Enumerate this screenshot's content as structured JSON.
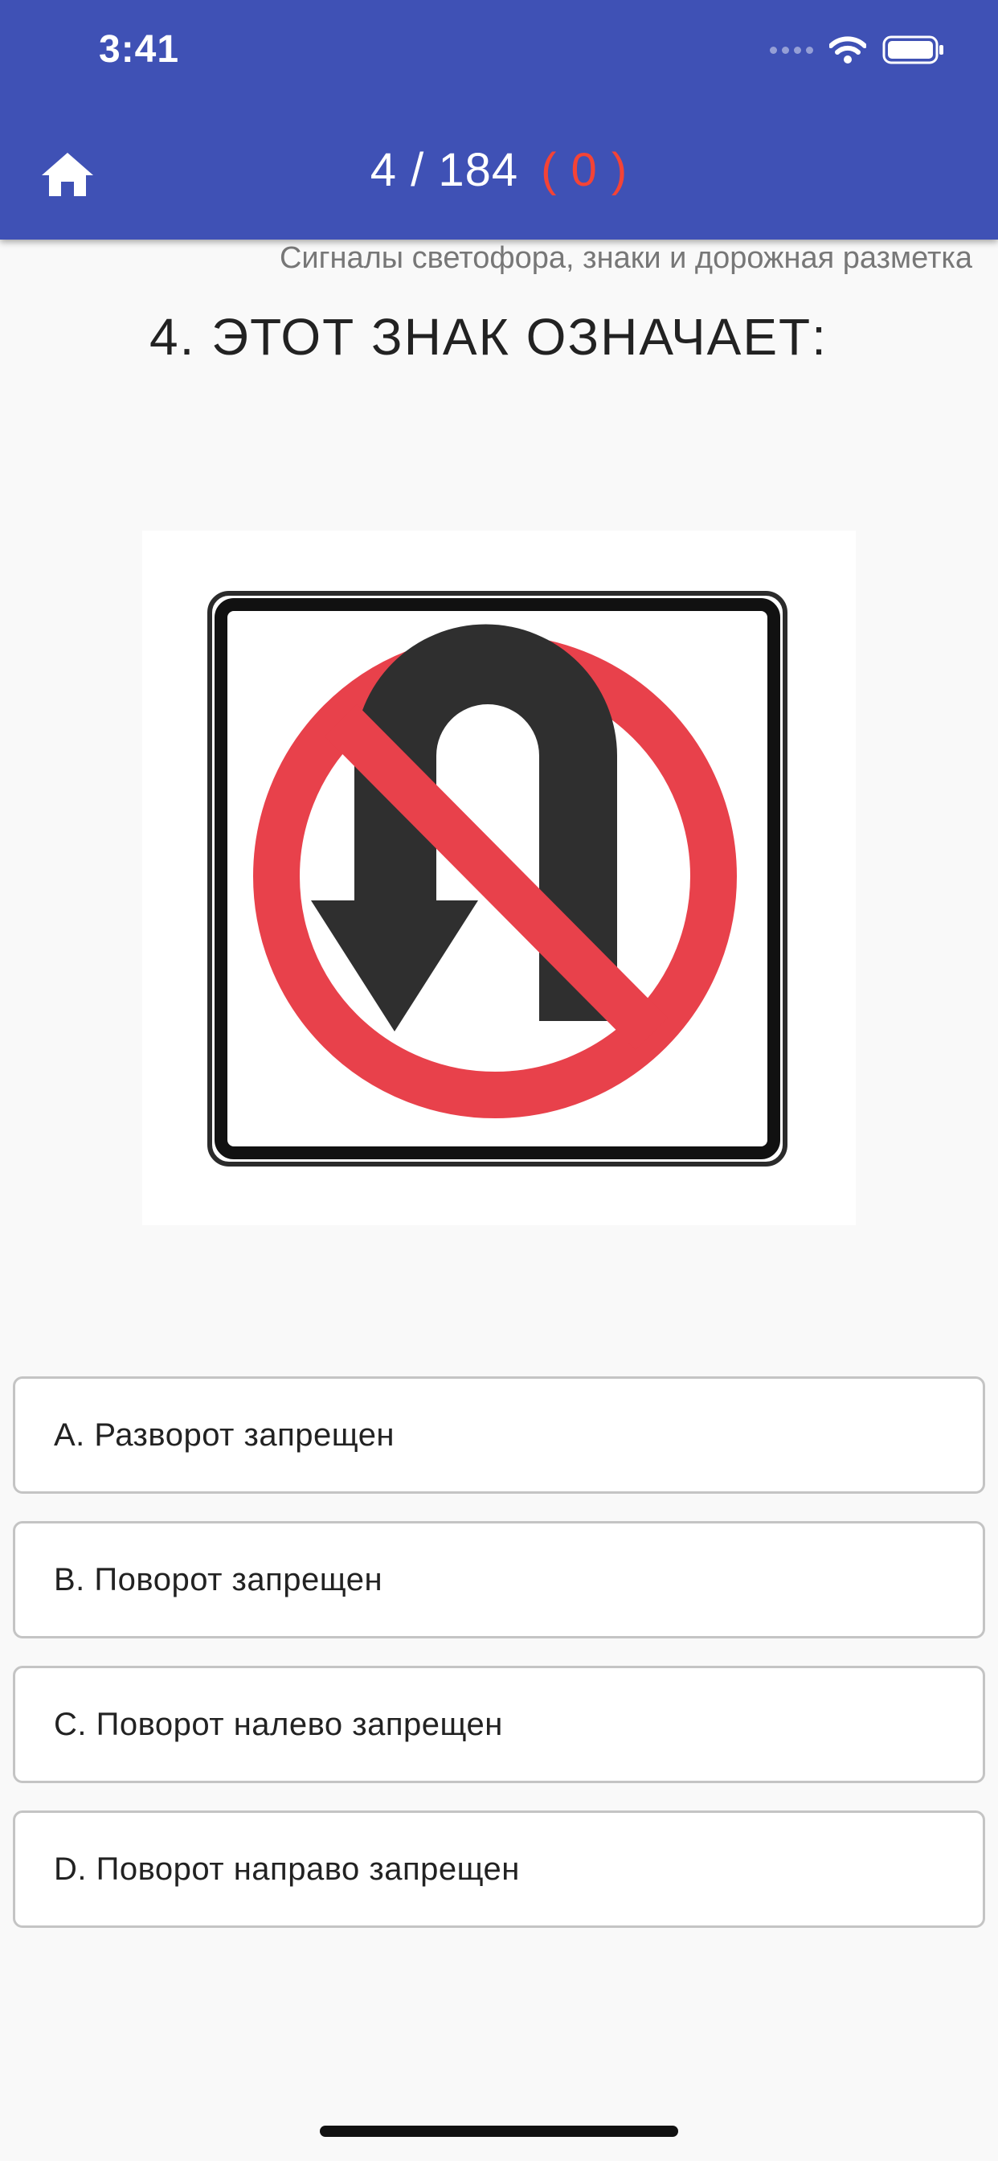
{
  "status_bar": {
    "time": "3:41"
  },
  "header": {
    "progress": "4 / 184",
    "errors": "( 0 )",
    "colors": {
      "app_bar": "#3f51b5",
      "errors_text": "#f44336"
    }
  },
  "question": {
    "category": "Сигналы светофора, знаки и дорожная разметка",
    "text": "4. ЭТОТ ЗНАК ОЗНАЧАЕТ:"
  },
  "image": {
    "icon": "no-u-turn-sign-icon"
  },
  "answers": [
    {
      "label": "A. Разворот запрещен"
    },
    {
      "label": "B. Поворот запрещен"
    },
    {
      "label": "C. Поворот налево запрещен"
    },
    {
      "label": "D. Поворот направо запрещен"
    }
  ]
}
